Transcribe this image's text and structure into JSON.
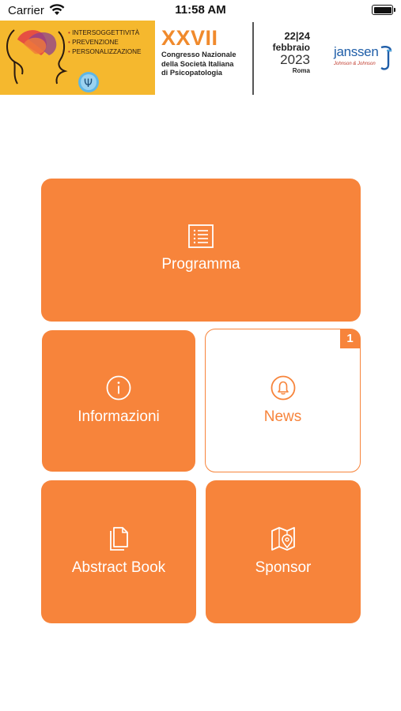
{
  "status_bar": {
    "carrier": "Carrier",
    "time": "11:58 AM"
  },
  "banner": {
    "tags": [
      "INTERSOGGETTIVITÀ",
      "PREVENZIONE",
      "PERSONALIZZAZIONE"
    ],
    "ordinal": "XXVII",
    "congress_lines": [
      "Congresso Nazionale",
      "della Società Italiana",
      "di Psicopatologia"
    ],
    "days": "22|24",
    "month": "febbraio",
    "year": "2023",
    "city": "Roma",
    "sponsor_name": "janssen",
    "sponsor_parent": "Johnson & Johnson",
    "colors": {
      "art_bg": "#f5b82e",
      "ordinal": "#f08a2c"
    }
  },
  "tiles": {
    "programma": {
      "label": "Programma",
      "icon": "list-icon"
    },
    "informazioni": {
      "label": "Informazioni",
      "icon": "info-icon"
    },
    "news": {
      "label": "News",
      "icon": "bell-icon",
      "badge": "1"
    },
    "abstract_book": {
      "label": "Abstract Book",
      "icon": "documents-icon"
    },
    "sponsor": {
      "label": "Sponsor",
      "icon": "map-pin-icon"
    }
  },
  "colors": {
    "accent": "#f7843b",
    "tile_text": "#ffffff"
  }
}
